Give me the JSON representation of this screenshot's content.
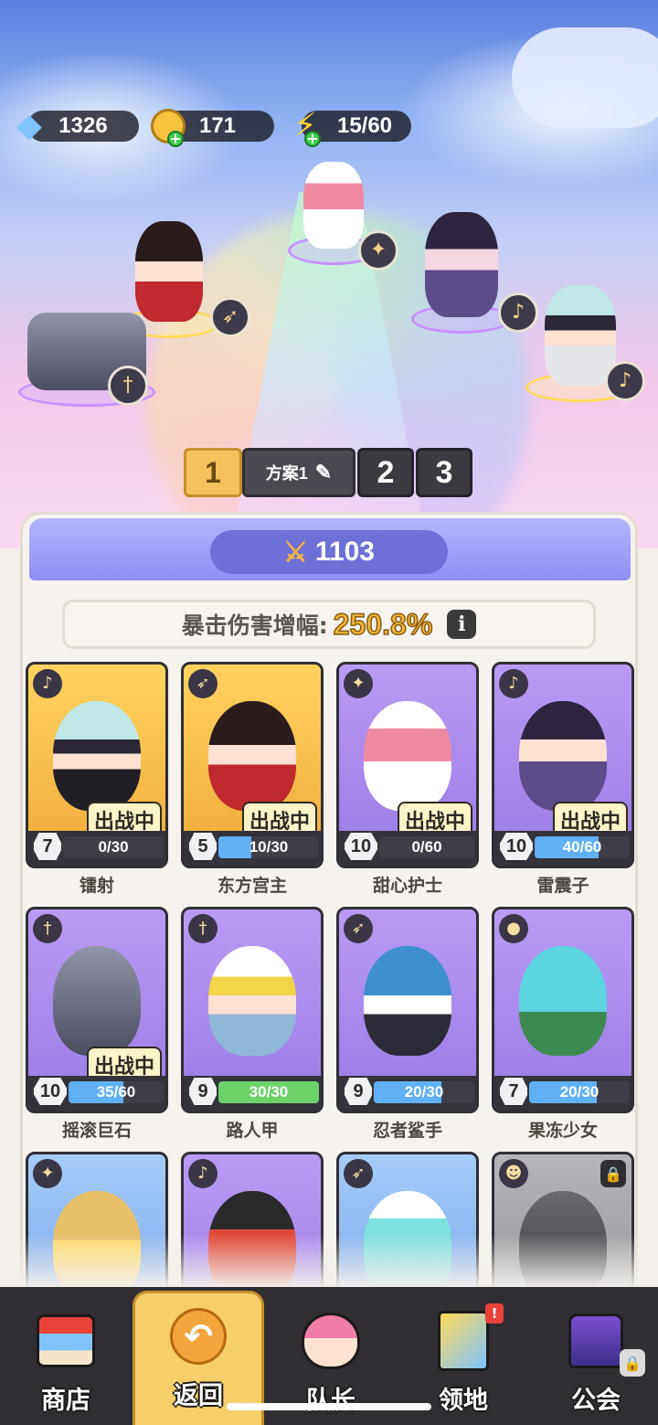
{
  "resources": {
    "gems": "1326",
    "coins": "171",
    "energy": "15/60"
  },
  "plans": {
    "active_number": "1",
    "active_name": "方案1",
    "others": [
      "2",
      "3"
    ]
  },
  "power": "1103",
  "crit": {
    "label": "暴击伤害增幅:",
    "value": "250.8%"
  },
  "in_battle_label": "出战中",
  "heroes": [
    {
      "name": "镭射",
      "level": "7",
      "progress": "0/30",
      "progress_fraction": 0.0,
      "card_color": "gold",
      "role_icon": "mage-icon",
      "in_battle": true
    },
    {
      "name": "东方宫主",
      "level": "5",
      "progress": "10/30",
      "progress_fraction": 0.33,
      "card_color": "gold",
      "role_icon": "bow-icon",
      "in_battle": true
    },
    {
      "name": "甜心护士",
      "level": "10",
      "progress": "0/60",
      "progress_fraction": 0.0,
      "card_color": "purple",
      "role_icon": "wings-icon",
      "in_battle": true
    },
    {
      "name": "雷震子",
      "level": "10",
      "progress": "40/60",
      "progress_fraction": 0.67,
      "card_color": "purple",
      "role_icon": "mage-icon",
      "in_battle": true
    },
    {
      "name": "摇滚巨石",
      "level": "10",
      "progress": "35/60",
      "progress_fraction": 0.58,
      "card_color": "purple",
      "role_icon": "sword-icon",
      "in_battle": true
    },
    {
      "name": "路人甲",
      "level": "9",
      "progress": "30/30",
      "progress_fraction": 1.0,
      "card_color": "purple",
      "role_icon": "sword-icon",
      "in_battle": false
    },
    {
      "name": "忍者鲨手",
      "level": "9",
      "progress": "20/30",
      "progress_fraction": 0.67,
      "card_color": "purple",
      "role_icon": "bow-icon",
      "in_battle": false
    },
    {
      "name": "果冻少女",
      "level": "7",
      "progress": "20/30",
      "progress_fraction": 0.67,
      "card_color": "purple",
      "role_icon": "potion-icon",
      "in_battle": false
    },
    {
      "name": "",
      "level": "",
      "progress": "",
      "card_color": "blue",
      "role_icon": "wings-icon",
      "in_battle": false
    },
    {
      "name": "",
      "level": "",
      "progress": "",
      "card_color": "purple",
      "role_icon": "mage-icon",
      "in_battle": false
    },
    {
      "name": "",
      "level": "",
      "progress": "",
      "card_color": "blue",
      "role_icon": "bow-icon",
      "in_battle": false
    },
    {
      "name": "",
      "level": "",
      "progress": "",
      "card_color": "grey",
      "role_icon": "demon-icon",
      "in_battle": false,
      "locked": true
    }
  ],
  "nav": {
    "shop": "商店",
    "back": "返回",
    "captain": "队长",
    "territory": "领地",
    "guild": "公会",
    "territory_badge": "!"
  },
  "colors": {
    "accent_gold": "#f3c25c",
    "power_purple": "#8e8ef5",
    "crit_gold": "#f0b83a",
    "progress_blue": "#5fb0f5",
    "progress_green": "#6ed26a"
  }
}
